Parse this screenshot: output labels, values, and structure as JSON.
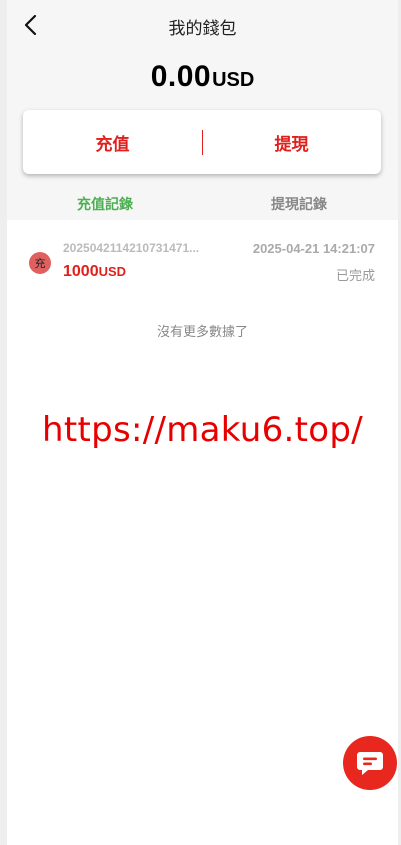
{
  "header": {
    "title": "我的錢包",
    "back_icon": "chevron-left-icon"
  },
  "balance": {
    "amount": "0.00",
    "currency": "USD"
  },
  "actions": {
    "deposit_label": "充值",
    "withdraw_label": "提現"
  },
  "tabs": [
    {
      "label": "充值記錄",
      "active": true
    },
    {
      "label": "提現記錄",
      "active": false
    }
  ],
  "records": [
    {
      "icon_label": "充",
      "id": "2025042114210731471...",
      "amount": "1000",
      "currency": "USD",
      "time": "2025-04-21 14:21:07",
      "status": "已完成"
    }
  ],
  "list_end_text": "沒有更多數據了",
  "watermark": "https://maku6.top/",
  "colors": {
    "accent_red": "#e0201c",
    "active_tab_green": "#4caf50",
    "fab_red": "#e8281e"
  },
  "chat_fab_icon": "chat-bubble-icon"
}
